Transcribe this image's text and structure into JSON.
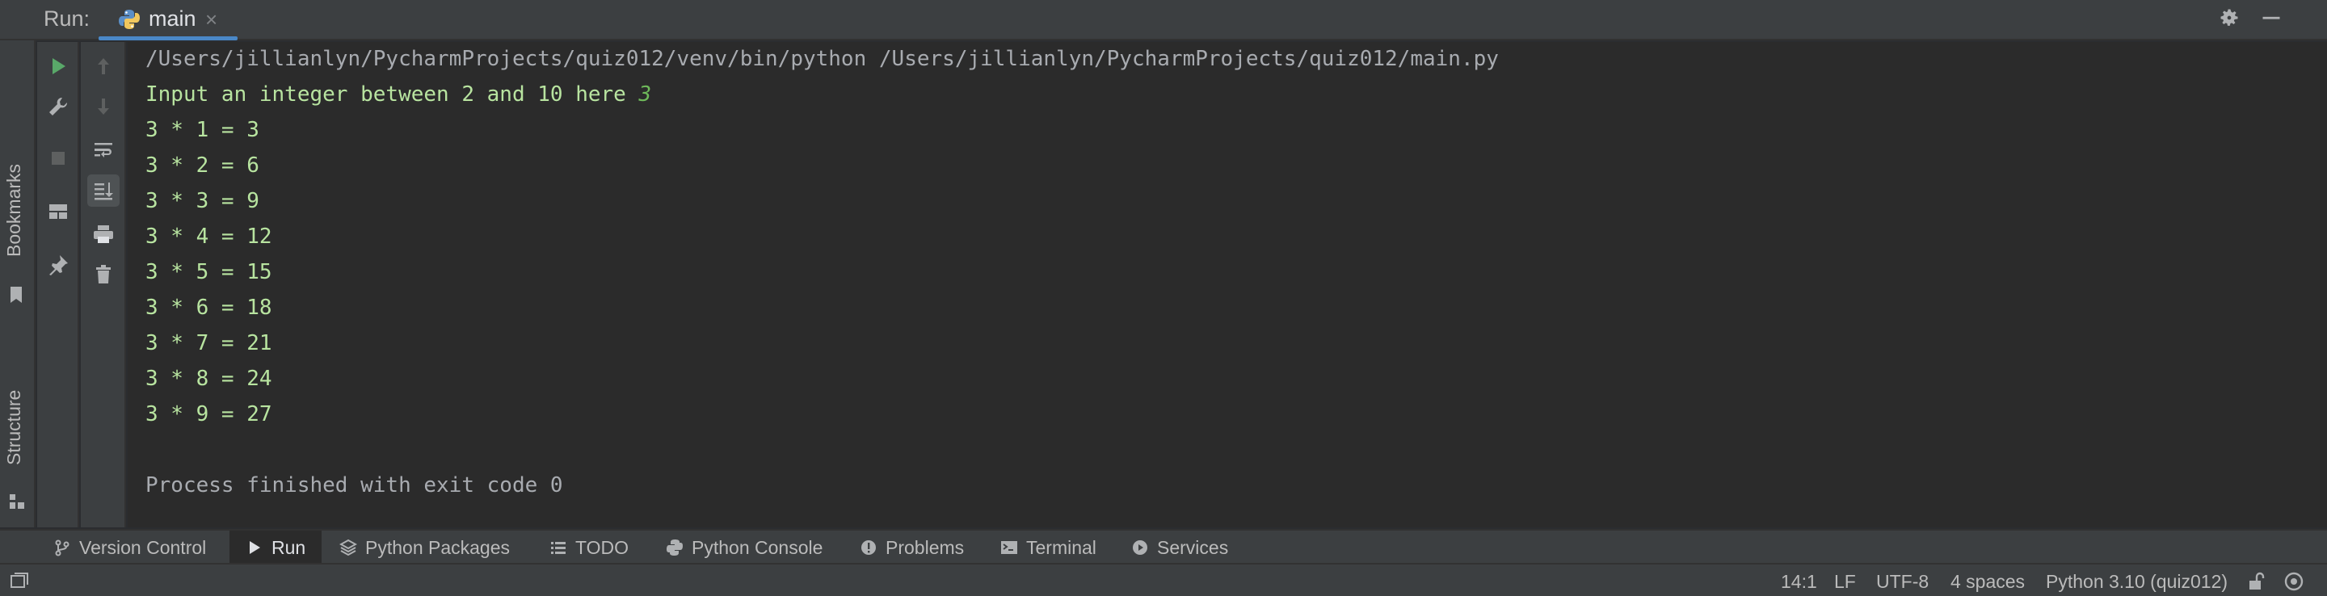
{
  "run_panel": {
    "label": "Run:",
    "tab_title": "main",
    "tab_close": "×"
  },
  "side_tabs": {
    "bookmarks": "Bookmarks",
    "structure": "Structure"
  },
  "console": {
    "command": "/Users/jillianlyn/PycharmProjects/quiz012/venv/bin/python /Users/jillianlyn/PycharmProjects/quiz012/main.py",
    "prompt": "Input an integer between 2 and 10 here ",
    "user_input": "3",
    "output_lines": [
      "3 * 1 = 3",
      "3 * 2 = 6",
      "3 * 3 = 9",
      "3 * 4 = 12",
      "3 * 5 = 15",
      "3 * 6 = 18",
      "3 * 7 = 21",
      "3 * 8 = 24",
      "3 * 9 = 27"
    ],
    "exit_message": "Process finished with exit code 0"
  },
  "tool_windows": [
    {
      "label": "Version Control",
      "icon": "branch-icon"
    },
    {
      "label": "Run",
      "icon": "play-icon",
      "active": true
    },
    {
      "label": "Python Packages",
      "icon": "layers-icon"
    },
    {
      "label": "TODO",
      "icon": "list-icon"
    },
    {
      "label": "Python Console",
      "icon": "python-icon"
    },
    {
      "label": "Problems",
      "icon": "info-icon"
    },
    {
      "label": "Terminal",
      "icon": "terminal-icon"
    },
    {
      "label": "Services",
      "icon": "services-icon"
    }
  ],
  "status": {
    "position": "14:1",
    "line_separator": "LF",
    "encoding": "UTF-8",
    "indent": "4 spaces",
    "interpreter": "Python 3.10 (quiz012)"
  },
  "colors": {
    "accent": "#4a88c7",
    "run_green": "#59a869",
    "output_green": "#b8e4a0"
  }
}
